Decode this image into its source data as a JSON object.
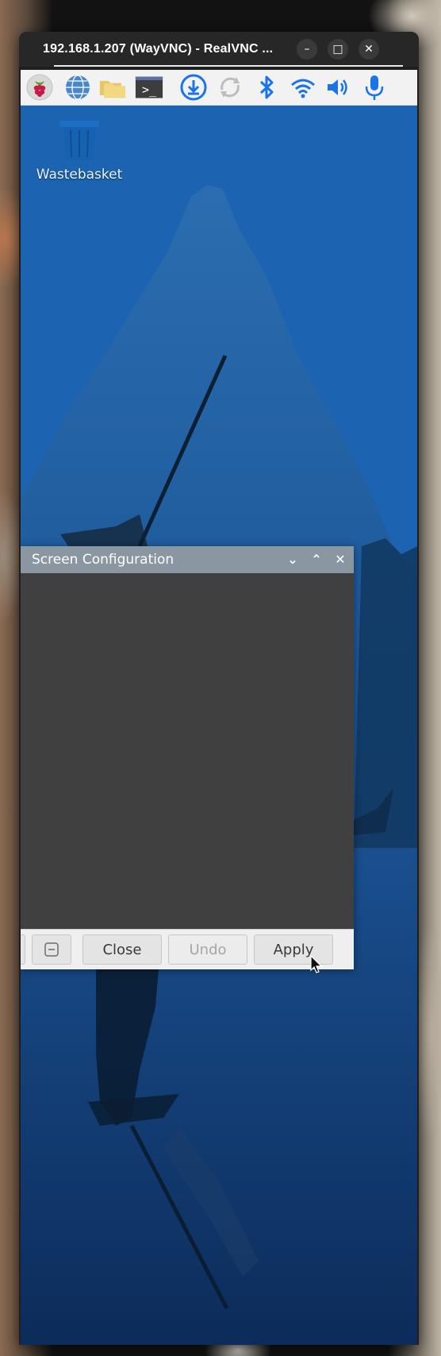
{
  "vnc_window": {
    "title": "192.168.1.207 (WayVNC) - RealVNC ...",
    "controls": {
      "minimize": "–",
      "maximize": "□",
      "close": "✕"
    }
  },
  "panel": {
    "icons": [
      "raspberry-pi-menu-icon",
      "web-browser-icon",
      "file-manager-icon",
      "terminal-icon",
      "software-update-icon",
      "sync-icon",
      "bluetooth-icon",
      "wifi-icon",
      "volume-icon",
      "microphone-icon"
    ],
    "terminal_glyph": ">_"
  },
  "desktop": {
    "wastebasket_label": "Wastebasket"
  },
  "screen_config": {
    "title": "Screen Configuration",
    "controls": {
      "minimize": "⌄",
      "maximize": "⌃",
      "close": "✕"
    },
    "buttons": {
      "close": "Close",
      "undo": "Undo",
      "apply": "Apply"
    }
  },
  "colors": {
    "desktop_blue": "#1d6ab8",
    "dialog_title_bar": "#8a96a1",
    "dialog_body": "#404040",
    "panel_bg": "#f2f2f2",
    "accent_blue": "#1a73e8"
  }
}
